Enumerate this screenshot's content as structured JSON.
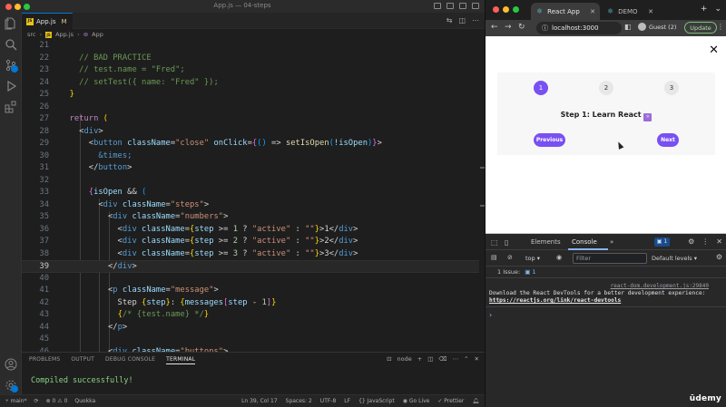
{
  "vscode": {
    "window_title": "App.js — 04-steps",
    "tab": {
      "filename": "App.js",
      "status": "M"
    },
    "breadcrumb": [
      "src",
      "App.js",
      "App"
    ],
    "editor_lines": [
      {
        "num": "21",
        "tokens": []
      },
      {
        "num": "22",
        "tokens": [
          {
            "t": "    // BAD PRACTICE",
            "c": "cmt"
          }
        ]
      },
      {
        "num": "23",
        "tokens": [
          {
            "t": "    // test.name = \"Fred\";",
            "c": "cmt"
          }
        ]
      },
      {
        "num": "24",
        "tokens": [
          {
            "t": "    // setTest({ name: \"Fred\" });",
            "c": "cmt"
          }
        ]
      },
      {
        "num": "25",
        "tokens": [
          {
            "t": "  ",
            "c": "op"
          },
          {
            "t": "}",
            "c": "br1"
          }
        ]
      },
      {
        "num": "26",
        "tokens": []
      },
      {
        "num": "27",
        "tokens": [
          {
            "t": "  ",
            "c": "op"
          },
          {
            "t": "return",
            "c": "kw"
          },
          {
            "t": " ",
            "c": "op"
          },
          {
            "t": "(",
            "c": "br1"
          }
        ]
      },
      {
        "num": "28",
        "tokens": [
          {
            "t": "    <",
            "c": "op"
          },
          {
            "t": "div",
            "c": "tag"
          },
          {
            "t": ">",
            "c": "op"
          }
        ]
      },
      {
        "num": "29",
        "tokens": [
          {
            "t": "      <",
            "c": "op"
          },
          {
            "t": "button",
            "c": "tag"
          },
          {
            "t": " ",
            "c": "op"
          },
          {
            "t": "className",
            "c": "attr"
          },
          {
            "t": "=",
            "c": "op"
          },
          {
            "t": "\"close\"",
            "c": "str"
          },
          {
            "t": " ",
            "c": "op"
          },
          {
            "t": "onClick",
            "c": "attr"
          },
          {
            "t": "=",
            "c": "op"
          },
          {
            "t": "{",
            "c": "br2"
          },
          {
            "t": "()",
            "c": "br3"
          },
          {
            "t": " => ",
            "c": "op"
          },
          {
            "t": "setIsOpen",
            "c": "fn"
          },
          {
            "t": "(",
            "c": "br3"
          },
          {
            "t": "!isOpen",
            "c": "attr"
          },
          {
            "t": ")",
            "c": "br3"
          },
          {
            "t": "}",
            "c": "br2"
          },
          {
            "t": ">",
            "c": "op"
          }
        ]
      },
      {
        "num": "30",
        "tokens": [
          {
            "t": "        ",
            "c": "op"
          },
          {
            "t": "&times;",
            "c": "ent"
          }
        ]
      },
      {
        "num": "31",
        "tokens": [
          {
            "t": "      </",
            "c": "op"
          },
          {
            "t": "button",
            "c": "tag"
          },
          {
            "t": ">",
            "c": "op"
          }
        ]
      },
      {
        "num": "32",
        "tokens": []
      },
      {
        "num": "33",
        "tokens": [
          {
            "t": "      ",
            "c": "op"
          },
          {
            "t": "{",
            "c": "br2"
          },
          {
            "t": "isOpen",
            "c": "attr"
          },
          {
            "t": " && ",
            "c": "op"
          },
          {
            "t": "(",
            "c": "br3"
          }
        ]
      },
      {
        "num": "34",
        "tokens": [
          {
            "t": "        <",
            "c": "op"
          },
          {
            "t": "div",
            "c": "tag"
          },
          {
            "t": " ",
            "c": "op"
          },
          {
            "t": "className",
            "c": "attr"
          },
          {
            "t": "=",
            "c": "op"
          },
          {
            "t": "\"steps\"",
            "c": "str"
          },
          {
            "t": ">",
            "c": "op"
          }
        ]
      },
      {
        "num": "35",
        "tokens": [
          {
            "t": "          <",
            "c": "op"
          },
          {
            "t": "div",
            "c": "tag"
          },
          {
            "t": " ",
            "c": "op"
          },
          {
            "t": "className",
            "c": "attr"
          },
          {
            "t": "=",
            "c": "op"
          },
          {
            "t": "\"numbers\"",
            "c": "str"
          },
          {
            "t": ">",
            "c": "op"
          }
        ]
      },
      {
        "num": "36",
        "tokens": [
          {
            "t": "            <",
            "c": "op"
          },
          {
            "t": "div",
            "c": "tag"
          },
          {
            "t": " ",
            "c": "op"
          },
          {
            "t": "className",
            "c": "attr"
          },
          {
            "t": "=",
            "c": "op"
          },
          {
            "t": "{",
            "c": "br1"
          },
          {
            "t": "step",
            "c": "attr"
          },
          {
            "t": " >= ",
            "c": "op"
          },
          {
            "t": "1",
            "c": "num"
          },
          {
            "t": " ? ",
            "c": "op"
          },
          {
            "t": "\"active\"",
            "c": "str"
          },
          {
            "t": " : ",
            "c": "op"
          },
          {
            "t": "\"\"",
            "c": "str"
          },
          {
            "t": "}",
            "c": "br1"
          },
          {
            "t": ">1</",
            "c": "op"
          },
          {
            "t": "div",
            "c": "tag"
          },
          {
            "t": ">",
            "c": "op"
          }
        ]
      },
      {
        "num": "37",
        "tokens": [
          {
            "t": "            <",
            "c": "op"
          },
          {
            "t": "div",
            "c": "tag"
          },
          {
            "t": " ",
            "c": "op"
          },
          {
            "t": "className",
            "c": "attr"
          },
          {
            "t": "=",
            "c": "op"
          },
          {
            "t": "{",
            "c": "br1"
          },
          {
            "t": "step",
            "c": "attr"
          },
          {
            "t": " >= ",
            "c": "op"
          },
          {
            "t": "2",
            "c": "num"
          },
          {
            "t": " ? ",
            "c": "op"
          },
          {
            "t": "\"active\"",
            "c": "str"
          },
          {
            "t": " : ",
            "c": "op"
          },
          {
            "t": "\"\"",
            "c": "str"
          },
          {
            "t": "}",
            "c": "br1"
          },
          {
            "t": ">2</",
            "c": "op"
          },
          {
            "t": "div",
            "c": "tag"
          },
          {
            "t": ">",
            "c": "op"
          }
        ]
      },
      {
        "num": "38",
        "tokens": [
          {
            "t": "            <",
            "c": "op"
          },
          {
            "t": "div",
            "c": "tag"
          },
          {
            "t": " ",
            "c": "op"
          },
          {
            "t": "className",
            "c": "attr"
          },
          {
            "t": "=",
            "c": "op"
          },
          {
            "t": "{",
            "c": "br1"
          },
          {
            "t": "step",
            "c": "attr"
          },
          {
            "t": " >= ",
            "c": "op"
          },
          {
            "t": "3",
            "c": "num"
          },
          {
            "t": " ? ",
            "c": "op"
          },
          {
            "t": "\"active\"",
            "c": "str"
          },
          {
            "t": " : ",
            "c": "op"
          },
          {
            "t": "\"\"",
            "c": "str"
          },
          {
            "t": "}",
            "c": "br1"
          },
          {
            "t": ">3</",
            "c": "op"
          },
          {
            "t": "div",
            "c": "tag"
          },
          {
            "t": ">",
            "c": "op"
          }
        ]
      },
      {
        "num": "39",
        "current": true,
        "tokens": [
          {
            "t": "          </",
            "c": "op"
          },
          {
            "t": "div",
            "c": "tag"
          },
          {
            "t": ">",
            "c": "op"
          }
        ]
      },
      {
        "num": "40",
        "tokens": []
      },
      {
        "num": "41",
        "tokens": [
          {
            "t": "          <",
            "c": "op"
          },
          {
            "t": "p",
            "c": "tag"
          },
          {
            "t": " ",
            "c": "op"
          },
          {
            "t": "className",
            "c": "attr"
          },
          {
            "t": "=",
            "c": "op"
          },
          {
            "t": "\"message\"",
            "c": "str"
          },
          {
            "t": ">",
            "c": "op"
          }
        ]
      },
      {
        "num": "42",
        "tokens": [
          {
            "t": "            Step ",
            "c": "op"
          },
          {
            "t": "{",
            "c": "br1"
          },
          {
            "t": "step",
            "c": "attr"
          },
          {
            "t": "}",
            "c": "br1"
          },
          {
            "t": ": ",
            "c": "op"
          },
          {
            "t": "{",
            "c": "br1"
          },
          {
            "t": "messages",
            "c": "attr"
          },
          {
            "t": "[",
            "c": "br2"
          },
          {
            "t": "step",
            "c": "attr"
          },
          {
            "t": " - ",
            "c": "op"
          },
          {
            "t": "1",
            "c": "num"
          },
          {
            "t": "]",
            "c": "br2"
          },
          {
            "t": "}",
            "c": "br1"
          }
        ]
      },
      {
        "num": "43",
        "tokens": [
          {
            "t": "            ",
            "c": "op"
          },
          {
            "t": "{",
            "c": "br1"
          },
          {
            "t": "/* {test.name} */",
            "c": "cmt"
          },
          {
            "t": "}",
            "c": "br1"
          }
        ]
      },
      {
        "num": "44",
        "tokens": [
          {
            "t": "          </",
            "c": "op"
          },
          {
            "t": "p",
            "c": "tag"
          },
          {
            "t": ">",
            "c": "op"
          }
        ]
      },
      {
        "num": "45",
        "tokens": []
      },
      {
        "num": "46",
        "tokens": [
          {
            "t": "          <",
            "c": "op"
          },
          {
            "t": "div",
            "c": "tag"
          },
          {
            "t": " ",
            "c": "op"
          },
          {
            "t": "className",
            "c": "attr"
          },
          {
            "t": "=",
            "c": "op"
          },
          {
            "t": "\"buttons\"",
            "c": "str"
          },
          {
            "t": ">",
            "c": "op"
          }
        ]
      }
    ],
    "panel": {
      "tabs": [
        "PROBLEMS",
        "OUTPUT",
        "DEBUG CONSOLE",
        "TERMINAL"
      ],
      "active_tab": "TERMINAL",
      "terminal_name": "node",
      "terminal_output": "Compiled successfully!"
    },
    "statusbar": {
      "branch": "main*",
      "problems": "0",
      "warnings": "0",
      "quokka": "Quokka",
      "cursor_pos": "Ln 39, Col 17",
      "spaces": "Spaces: 2",
      "encoding": "UTF-8",
      "eol": "LF",
      "language": "JavaScript",
      "golive": "Go Live",
      "prettier": "Prettier"
    }
  },
  "chrome": {
    "tabs": [
      {
        "title": "React App",
        "active": true
      },
      {
        "title": "DEMO",
        "active": false
      }
    ],
    "url": "localhost:3000",
    "profile": "Guest (2)",
    "update_label": "Update",
    "page": {
      "close_symbol": "✕",
      "steps": [
        {
          "num": "1",
          "active": true
        },
        {
          "num": "2",
          "active": false
        },
        {
          "num": "3",
          "active": false
        }
      ],
      "message": "Step 1: Learn React",
      "previous_label": "Previous",
      "next_label": "Next"
    },
    "devtools": {
      "tabs": [
        "Elements",
        "Console"
      ],
      "active_tab": "Console",
      "issues_count": "1",
      "context": "top",
      "filter_placeholder": "Filter",
      "levels": "Default levels",
      "issues_bar_label": "1 Issue:",
      "issues_bar_count": "1",
      "log_source": "react-dom.development.js:29840",
      "log_message": "Download the React DevTools for a better development experience: ",
      "log_link": "https://reactjs.org/link/react-devtools"
    }
  },
  "watermark": "ūdemy",
  "colors": {
    "accent_purple": "#7950f2",
    "vscode_blue": "#0078d4"
  }
}
